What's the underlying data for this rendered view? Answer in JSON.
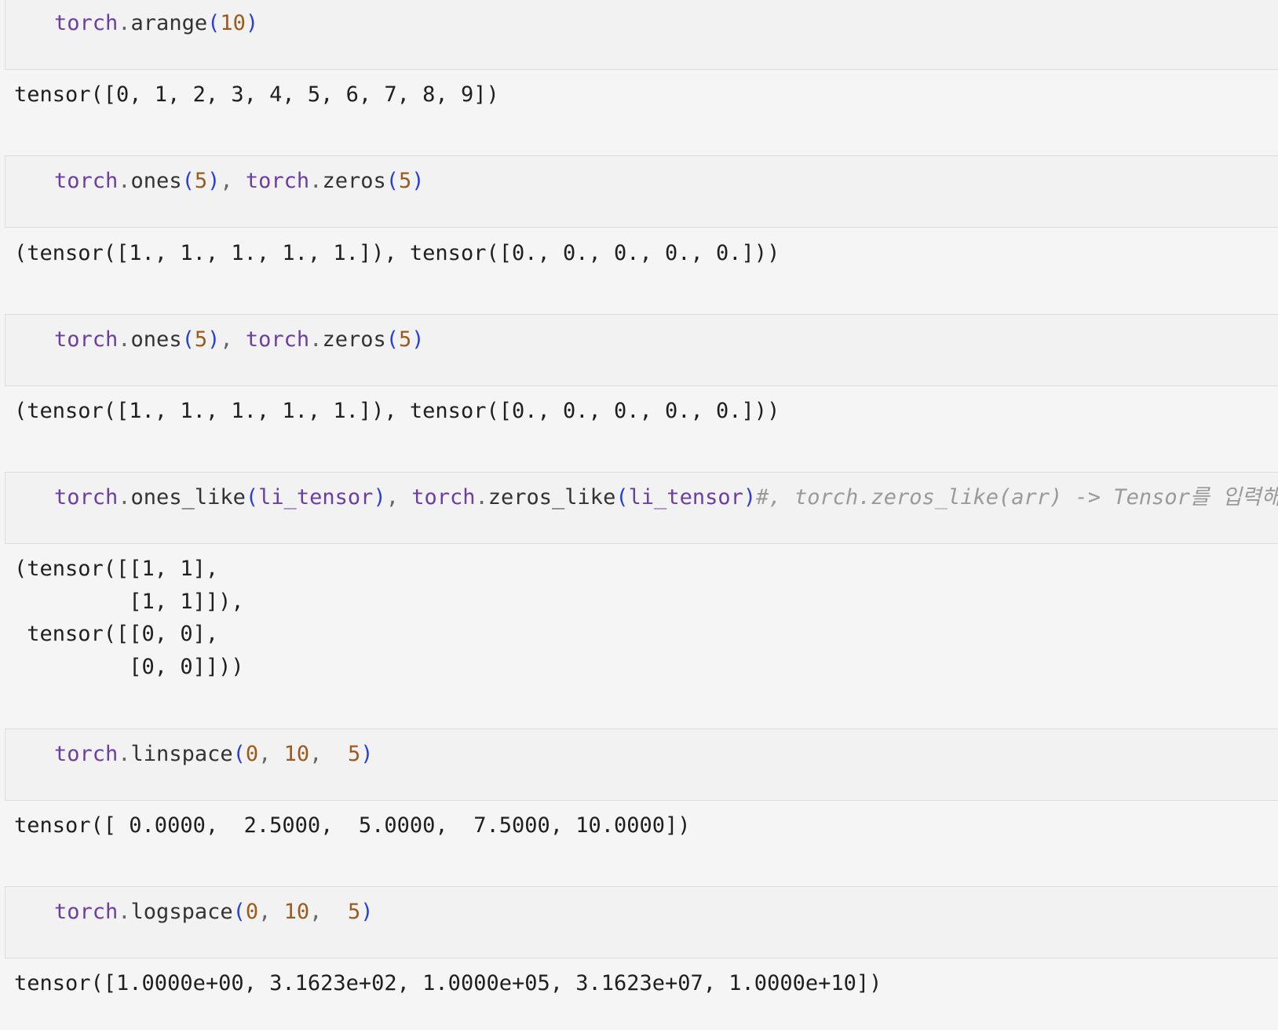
{
  "cells": [
    {
      "tokens": [
        {
          "text": "torch",
          "cls": "tok-mod"
        },
        {
          "text": ".",
          "cls": "tok-punct"
        },
        {
          "text": "arange",
          "cls": "tok-fn"
        },
        {
          "text": "(",
          "cls": "tok-paren"
        },
        {
          "text": "10",
          "cls": "tok-num"
        },
        {
          "text": ")",
          "cls": "tok-paren"
        }
      ],
      "output": "tensor([0, 1, 2, 3, 4, 5, 6, 7, 8, 9])"
    },
    {
      "tokens": [
        {
          "text": "torch",
          "cls": "tok-mod"
        },
        {
          "text": ".",
          "cls": "tok-punct"
        },
        {
          "text": "ones",
          "cls": "tok-fn"
        },
        {
          "text": "(",
          "cls": "tok-paren"
        },
        {
          "text": "5",
          "cls": "tok-num"
        },
        {
          "text": ")",
          "cls": "tok-paren"
        },
        {
          "text": ", ",
          "cls": "tok-punct"
        },
        {
          "text": "torch",
          "cls": "tok-mod"
        },
        {
          "text": ".",
          "cls": "tok-punct"
        },
        {
          "text": "zeros",
          "cls": "tok-fn"
        },
        {
          "text": "(",
          "cls": "tok-paren"
        },
        {
          "text": "5",
          "cls": "tok-num"
        },
        {
          "text": ")",
          "cls": "tok-paren"
        }
      ],
      "output": "(tensor([1., 1., 1., 1., 1.]), tensor([0., 0., 0., 0., 0.]))"
    },
    {
      "tokens": [
        {
          "text": "torch",
          "cls": "tok-mod"
        },
        {
          "text": ".",
          "cls": "tok-punct"
        },
        {
          "text": "ones",
          "cls": "tok-fn"
        },
        {
          "text": "(",
          "cls": "tok-paren"
        },
        {
          "text": "5",
          "cls": "tok-num"
        },
        {
          "text": ")",
          "cls": "tok-paren"
        },
        {
          "text": ", ",
          "cls": "tok-punct"
        },
        {
          "text": "torch",
          "cls": "tok-mod"
        },
        {
          "text": ".",
          "cls": "tok-punct"
        },
        {
          "text": "zeros",
          "cls": "tok-fn"
        },
        {
          "text": "(",
          "cls": "tok-paren"
        },
        {
          "text": "5",
          "cls": "tok-num"
        },
        {
          "text": ")",
          "cls": "tok-paren"
        }
      ],
      "output": "(tensor([1., 1., 1., 1., 1.]), tensor([0., 0., 0., 0., 0.]))"
    },
    {
      "tokens": [
        {
          "text": "torch",
          "cls": "tok-mod"
        },
        {
          "text": ".",
          "cls": "tok-punct"
        },
        {
          "text": "ones_like",
          "cls": "tok-fn"
        },
        {
          "text": "(",
          "cls": "tok-paren"
        },
        {
          "text": "li_tensor",
          "cls": "tok-var"
        },
        {
          "text": ")",
          "cls": "tok-paren"
        },
        {
          "text": ", ",
          "cls": "tok-punct"
        },
        {
          "text": "torch",
          "cls": "tok-mod"
        },
        {
          "text": ".",
          "cls": "tok-punct"
        },
        {
          "text": "zeros_like",
          "cls": "tok-fn"
        },
        {
          "text": "(",
          "cls": "tok-paren"
        },
        {
          "text": "li_tensor",
          "cls": "tok-var"
        },
        {
          "text": ")",
          "cls": "tok-paren"
        },
        {
          "text": "#, torch.zeros_like(arr) -> Tensor를 입력해야함.",
          "cls": "tok-comment"
        }
      ],
      "output": "(tensor([[1, 1],\n         [1, 1]]),\n tensor([[0, 0],\n         [0, 0]]))"
    },
    {
      "tokens": [
        {
          "text": "torch",
          "cls": "tok-mod"
        },
        {
          "text": ".",
          "cls": "tok-punct"
        },
        {
          "text": "linspace",
          "cls": "tok-fn"
        },
        {
          "text": "(",
          "cls": "tok-paren"
        },
        {
          "text": "0",
          "cls": "tok-num"
        },
        {
          "text": ", ",
          "cls": "tok-punct"
        },
        {
          "text": "10",
          "cls": "tok-num"
        },
        {
          "text": ",  ",
          "cls": "tok-punct"
        },
        {
          "text": "5",
          "cls": "tok-num"
        },
        {
          "text": ")",
          "cls": "tok-paren"
        }
      ],
      "output": "tensor([ 0.0000,  2.5000,  5.0000,  7.5000, 10.0000])"
    },
    {
      "tokens": [
        {
          "text": "torch",
          "cls": "tok-mod"
        },
        {
          "text": ".",
          "cls": "tok-punct"
        },
        {
          "text": "logspace",
          "cls": "tok-fn"
        },
        {
          "text": "(",
          "cls": "tok-paren"
        },
        {
          "text": "0",
          "cls": "tok-num"
        },
        {
          "text": ", ",
          "cls": "tok-punct"
        },
        {
          "text": "10",
          "cls": "tok-num"
        },
        {
          "text": ",  ",
          "cls": "tok-punct"
        },
        {
          "text": "5",
          "cls": "tok-num"
        },
        {
          "text": ")",
          "cls": "tok-paren"
        }
      ],
      "output": "tensor([1.0000e+00, 3.1623e+02, 1.0000e+05, 3.1623e+07, 1.0000e+10])"
    }
  ]
}
